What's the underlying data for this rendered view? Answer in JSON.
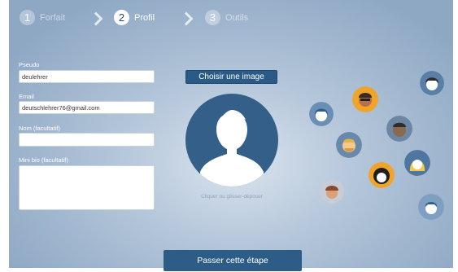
{
  "steps": [
    {
      "num": "1",
      "label": "Forfait"
    },
    {
      "num": "2",
      "label": "Profil"
    },
    {
      "num": "3",
      "label": "Outils"
    }
  ],
  "form": {
    "pseudo_label": "Pseudo",
    "pseudo_value": "deulehrer",
    "email_label": "Email",
    "email_value": "deutschlehrer76@gmail.com",
    "name_label": "Nom (facultatif)",
    "name_value": "",
    "bio_label": "Mini bio (facultatif)",
    "bio_value": ""
  },
  "image": {
    "choose_label": "Choisir une image",
    "drop_hint": "Cliquer ou glisser-déposer"
  },
  "skip_label": "Passer cette étape",
  "colors": {
    "accent": "#2d5c86",
    "avatar_bg": "#345f88"
  }
}
